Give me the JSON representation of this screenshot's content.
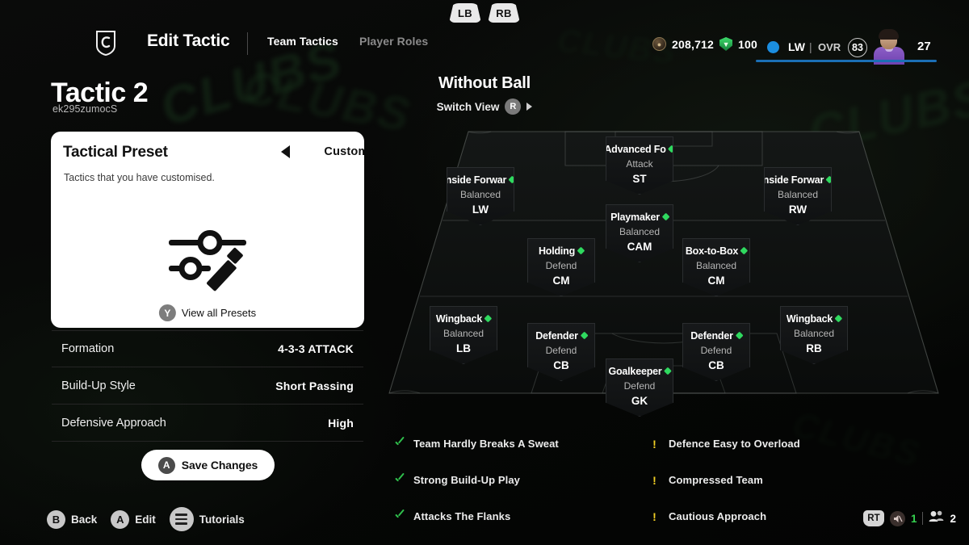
{
  "bumpers": {
    "left": "LB",
    "right": "RB"
  },
  "header": {
    "crest_icon": "club-crest-icon",
    "title": "Edit Tactic",
    "tabs": [
      {
        "label": "Team Tactics",
        "active": true
      },
      {
        "label": "Player Roles",
        "active": false
      }
    ],
    "currency": {
      "coins_icon": "coin-icon",
      "coins": "208,712",
      "points_icon": "green-gem-icon",
      "points": "100"
    },
    "player": {
      "status_icon": "blue-dot-icon",
      "position": "LW",
      "separator": "|",
      "ovr_label": "OVR",
      "ovr_value": "83",
      "avatar": "player-avatar",
      "count": "27"
    }
  },
  "left": {
    "tactic_name": "Tactic 2",
    "tactic_id": "ek295zumocS",
    "preset_card": {
      "title": "Tactical Preset",
      "prev_icon": "arrow-left-icon",
      "value": "Custom",
      "next_icon": "arrow-right-icon",
      "description": "Tactics that you have customised.",
      "illustration_icon": "sliders-pencil-icon",
      "view_all_button": "Y",
      "view_all_label": "View all Presets"
    },
    "settings": [
      {
        "label": "Formation",
        "value": "4-3-3 ATTACK"
      },
      {
        "label": "Build-Up Style",
        "value": "Short Passing"
      },
      {
        "label": "Defensive Approach",
        "value": "High"
      }
    ],
    "save_button": {
      "button": "A",
      "label": "Save Changes"
    }
  },
  "pitch": {
    "title": "Without Ball",
    "switch_view_label": "Switch View",
    "switch_view_button": "R",
    "players": [
      {
        "role": "Advanced Fo",
        "focus": "Attack",
        "position": "ST"
      },
      {
        "role": "nside Forwar",
        "focus": "Balanced",
        "position": "LW"
      },
      {
        "role": "nside Forwar",
        "focus": "Balanced",
        "position": "RW"
      },
      {
        "role": "Playmaker",
        "focus": "Balanced",
        "position": "CAM"
      },
      {
        "role": "Holding",
        "focus": "Defend",
        "position": "CM"
      },
      {
        "role": "Box-to-Box",
        "focus": "Balanced",
        "position": "CM"
      },
      {
        "role": "Wingback",
        "focus": "Balanced",
        "position": "LB"
      },
      {
        "role": "Defender",
        "focus": "Defend",
        "position": "CB"
      },
      {
        "role": "Defender",
        "focus": "Defend",
        "position": "CB"
      },
      {
        "role": "Wingback",
        "focus": "Balanced",
        "position": "RB"
      },
      {
        "role": "Goalkeeper",
        "focus": "Defend",
        "position": "GK"
      }
    ]
  },
  "traits": {
    "pros": [
      "Team Hardly Breaks A Sweat",
      "Strong Build-Up Play",
      "Attacks The Flanks"
    ],
    "cons": [
      "Defence Easy to Overload",
      "Compressed Team",
      "Cautious Approach"
    ]
  },
  "bottom_bar": {
    "items": [
      {
        "button": "B",
        "label": "Back"
      },
      {
        "button": "A",
        "label": "Edit"
      },
      {
        "button": "menu-icon",
        "label": "Tutorials"
      }
    ],
    "right": {
      "trigger": "RT",
      "voice_icon": "speaker-muted-icon",
      "voice_count": "1",
      "party_icon": "people-icon",
      "party_count": "2"
    }
  },
  "colors": {
    "accent_green": "#2fd95f",
    "warning_yellow": "#f2d024",
    "card_white": "#ffffff",
    "player_blue": "#1b8ee0"
  }
}
